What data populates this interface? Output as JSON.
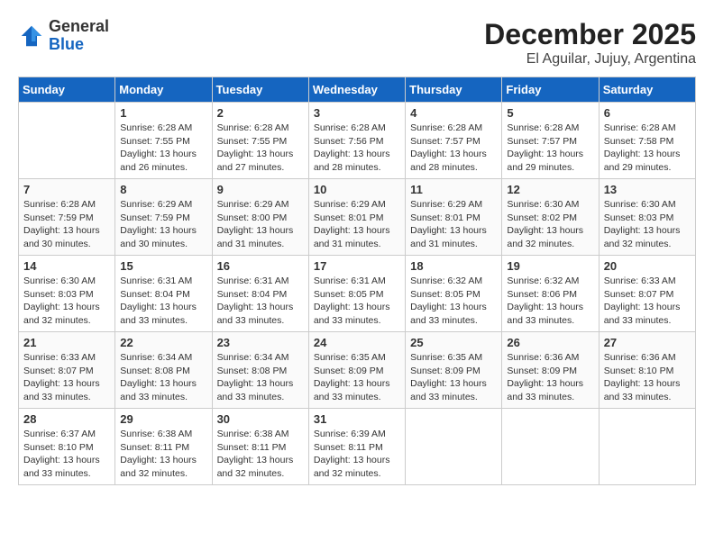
{
  "header": {
    "logo_general": "General",
    "logo_blue": "Blue",
    "month_title": "December 2025",
    "location": "El Aguilar, Jujuy, Argentina"
  },
  "days_of_week": [
    "Sunday",
    "Monday",
    "Tuesday",
    "Wednesday",
    "Thursday",
    "Friday",
    "Saturday"
  ],
  "weeks": [
    [
      {
        "day": "",
        "sunrise": "",
        "sunset": "",
        "daylight": ""
      },
      {
        "day": "1",
        "sunrise": "Sunrise: 6:28 AM",
        "sunset": "Sunset: 7:55 PM",
        "daylight": "Daylight: 13 hours and 26 minutes."
      },
      {
        "day": "2",
        "sunrise": "Sunrise: 6:28 AM",
        "sunset": "Sunset: 7:55 PM",
        "daylight": "Daylight: 13 hours and 27 minutes."
      },
      {
        "day": "3",
        "sunrise": "Sunrise: 6:28 AM",
        "sunset": "Sunset: 7:56 PM",
        "daylight": "Daylight: 13 hours and 28 minutes."
      },
      {
        "day": "4",
        "sunrise": "Sunrise: 6:28 AM",
        "sunset": "Sunset: 7:57 PM",
        "daylight": "Daylight: 13 hours and 28 minutes."
      },
      {
        "day": "5",
        "sunrise": "Sunrise: 6:28 AM",
        "sunset": "Sunset: 7:57 PM",
        "daylight": "Daylight: 13 hours and 29 minutes."
      },
      {
        "day": "6",
        "sunrise": "Sunrise: 6:28 AM",
        "sunset": "Sunset: 7:58 PM",
        "daylight": "Daylight: 13 hours and 29 minutes."
      }
    ],
    [
      {
        "day": "7",
        "sunrise": "Sunrise: 6:28 AM",
        "sunset": "Sunset: 7:59 PM",
        "daylight": "Daylight: 13 hours and 30 minutes."
      },
      {
        "day": "8",
        "sunrise": "Sunrise: 6:29 AM",
        "sunset": "Sunset: 7:59 PM",
        "daylight": "Daylight: 13 hours and 30 minutes."
      },
      {
        "day": "9",
        "sunrise": "Sunrise: 6:29 AM",
        "sunset": "Sunset: 8:00 PM",
        "daylight": "Daylight: 13 hours and 31 minutes."
      },
      {
        "day": "10",
        "sunrise": "Sunrise: 6:29 AM",
        "sunset": "Sunset: 8:01 PM",
        "daylight": "Daylight: 13 hours and 31 minutes."
      },
      {
        "day": "11",
        "sunrise": "Sunrise: 6:29 AM",
        "sunset": "Sunset: 8:01 PM",
        "daylight": "Daylight: 13 hours and 31 minutes."
      },
      {
        "day": "12",
        "sunrise": "Sunrise: 6:30 AM",
        "sunset": "Sunset: 8:02 PM",
        "daylight": "Daylight: 13 hours and 32 minutes."
      },
      {
        "day": "13",
        "sunrise": "Sunrise: 6:30 AM",
        "sunset": "Sunset: 8:03 PM",
        "daylight": "Daylight: 13 hours and 32 minutes."
      }
    ],
    [
      {
        "day": "14",
        "sunrise": "Sunrise: 6:30 AM",
        "sunset": "Sunset: 8:03 PM",
        "daylight": "Daylight: 13 hours and 32 minutes."
      },
      {
        "day": "15",
        "sunrise": "Sunrise: 6:31 AM",
        "sunset": "Sunset: 8:04 PM",
        "daylight": "Daylight: 13 hours and 33 minutes."
      },
      {
        "day": "16",
        "sunrise": "Sunrise: 6:31 AM",
        "sunset": "Sunset: 8:04 PM",
        "daylight": "Daylight: 13 hours and 33 minutes."
      },
      {
        "day": "17",
        "sunrise": "Sunrise: 6:31 AM",
        "sunset": "Sunset: 8:05 PM",
        "daylight": "Daylight: 13 hours and 33 minutes."
      },
      {
        "day": "18",
        "sunrise": "Sunrise: 6:32 AM",
        "sunset": "Sunset: 8:05 PM",
        "daylight": "Daylight: 13 hours and 33 minutes."
      },
      {
        "day": "19",
        "sunrise": "Sunrise: 6:32 AM",
        "sunset": "Sunset: 8:06 PM",
        "daylight": "Daylight: 13 hours and 33 minutes."
      },
      {
        "day": "20",
        "sunrise": "Sunrise: 6:33 AM",
        "sunset": "Sunset: 8:07 PM",
        "daylight": "Daylight: 13 hours and 33 minutes."
      }
    ],
    [
      {
        "day": "21",
        "sunrise": "Sunrise: 6:33 AM",
        "sunset": "Sunset: 8:07 PM",
        "daylight": "Daylight: 13 hours and 33 minutes."
      },
      {
        "day": "22",
        "sunrise": "Sunrise: 6:34 AM",
        "sunset": "Sunset: 8:08 PM",
        "daylight": "Daylight: 13 hours and 33 minutes."
      },
      {
        "day": "23",
        "sunrise": "Sunrise: 6:34 AM",
        "sunset": "Sunset: 8:08 PM",
        "daylight": "Daylight: 13 hours and 33 minutes."
      },
      {
        "day": "24",
        "sunrise": "Sunrise: 6:35 AM",
        "sunset": "Sunset: 8:09 PM",
        "daylight": "Daylight: 13 hours and 33 minutes."
      },
      {
        "day": "25",
        "sunrise": "Sunrise: 6:35 AM",
        "sunset": "Sunset: 8:09 PM",
        "daylight": "Daylight: 13 hours and 33 minutes."
      },
      {
        "day": "26",
        "sunrise": "Sunrise: 6:36 AM",
        "sunset": "Sunset: 8:09 PM",
        "daylight": "Daylight: 13 hours and 33 minutes."
      },
      {
        "day": "27",
        "sunrise": "Sunrise: 6:36 AM",
        "sunset": "Sunset: 8:10 PM",
        "daylight": "Daylight: 13 hours and 33 minutes."
      }
    ],
    [
      {
        "day": "28",
        "sunrise": "Sunrise: 6:37 AM",
        "sunset": "Sunset: 8:10 PM",
        "daylight": "Daylight: 13 hours and 33 minutes."
      },
      {
        "day": "29",
        "sunrise": "Sunrise: 6:38 AM",
        "sunset": "Sunset: 8:11 PM",
        "daylight": "Daylight: 13 hours and 32 minutes."
      },
      {
        "day": "30",
        "sunrise": "Sunrise: 6:38 AM",
        "sunset": "Sunset: 8:11 PM",
        "daylight": "Daylight: 13 hours and 32 minutes."
      },
      {
        "day": "31",
        "sunrise": "Sunrise: 6:39 AM",
        "sunset": "Sunset: 8:11 PM",
        "daylight": "Daylight: 13 hours and 32 minutes."
      },
      {
        "day": "",
        "sunrise": "",
        "sunset": "",
        "daylight": ""
      },
      {
        "day": "",
        "sunrise": "",
        "sunset": "",
        "daylight": ""
      },
      {
        "day": "",
        "sunrise": "",
        "sunset": "",
        "daylight": ""
      }
    ]
  ]
}
